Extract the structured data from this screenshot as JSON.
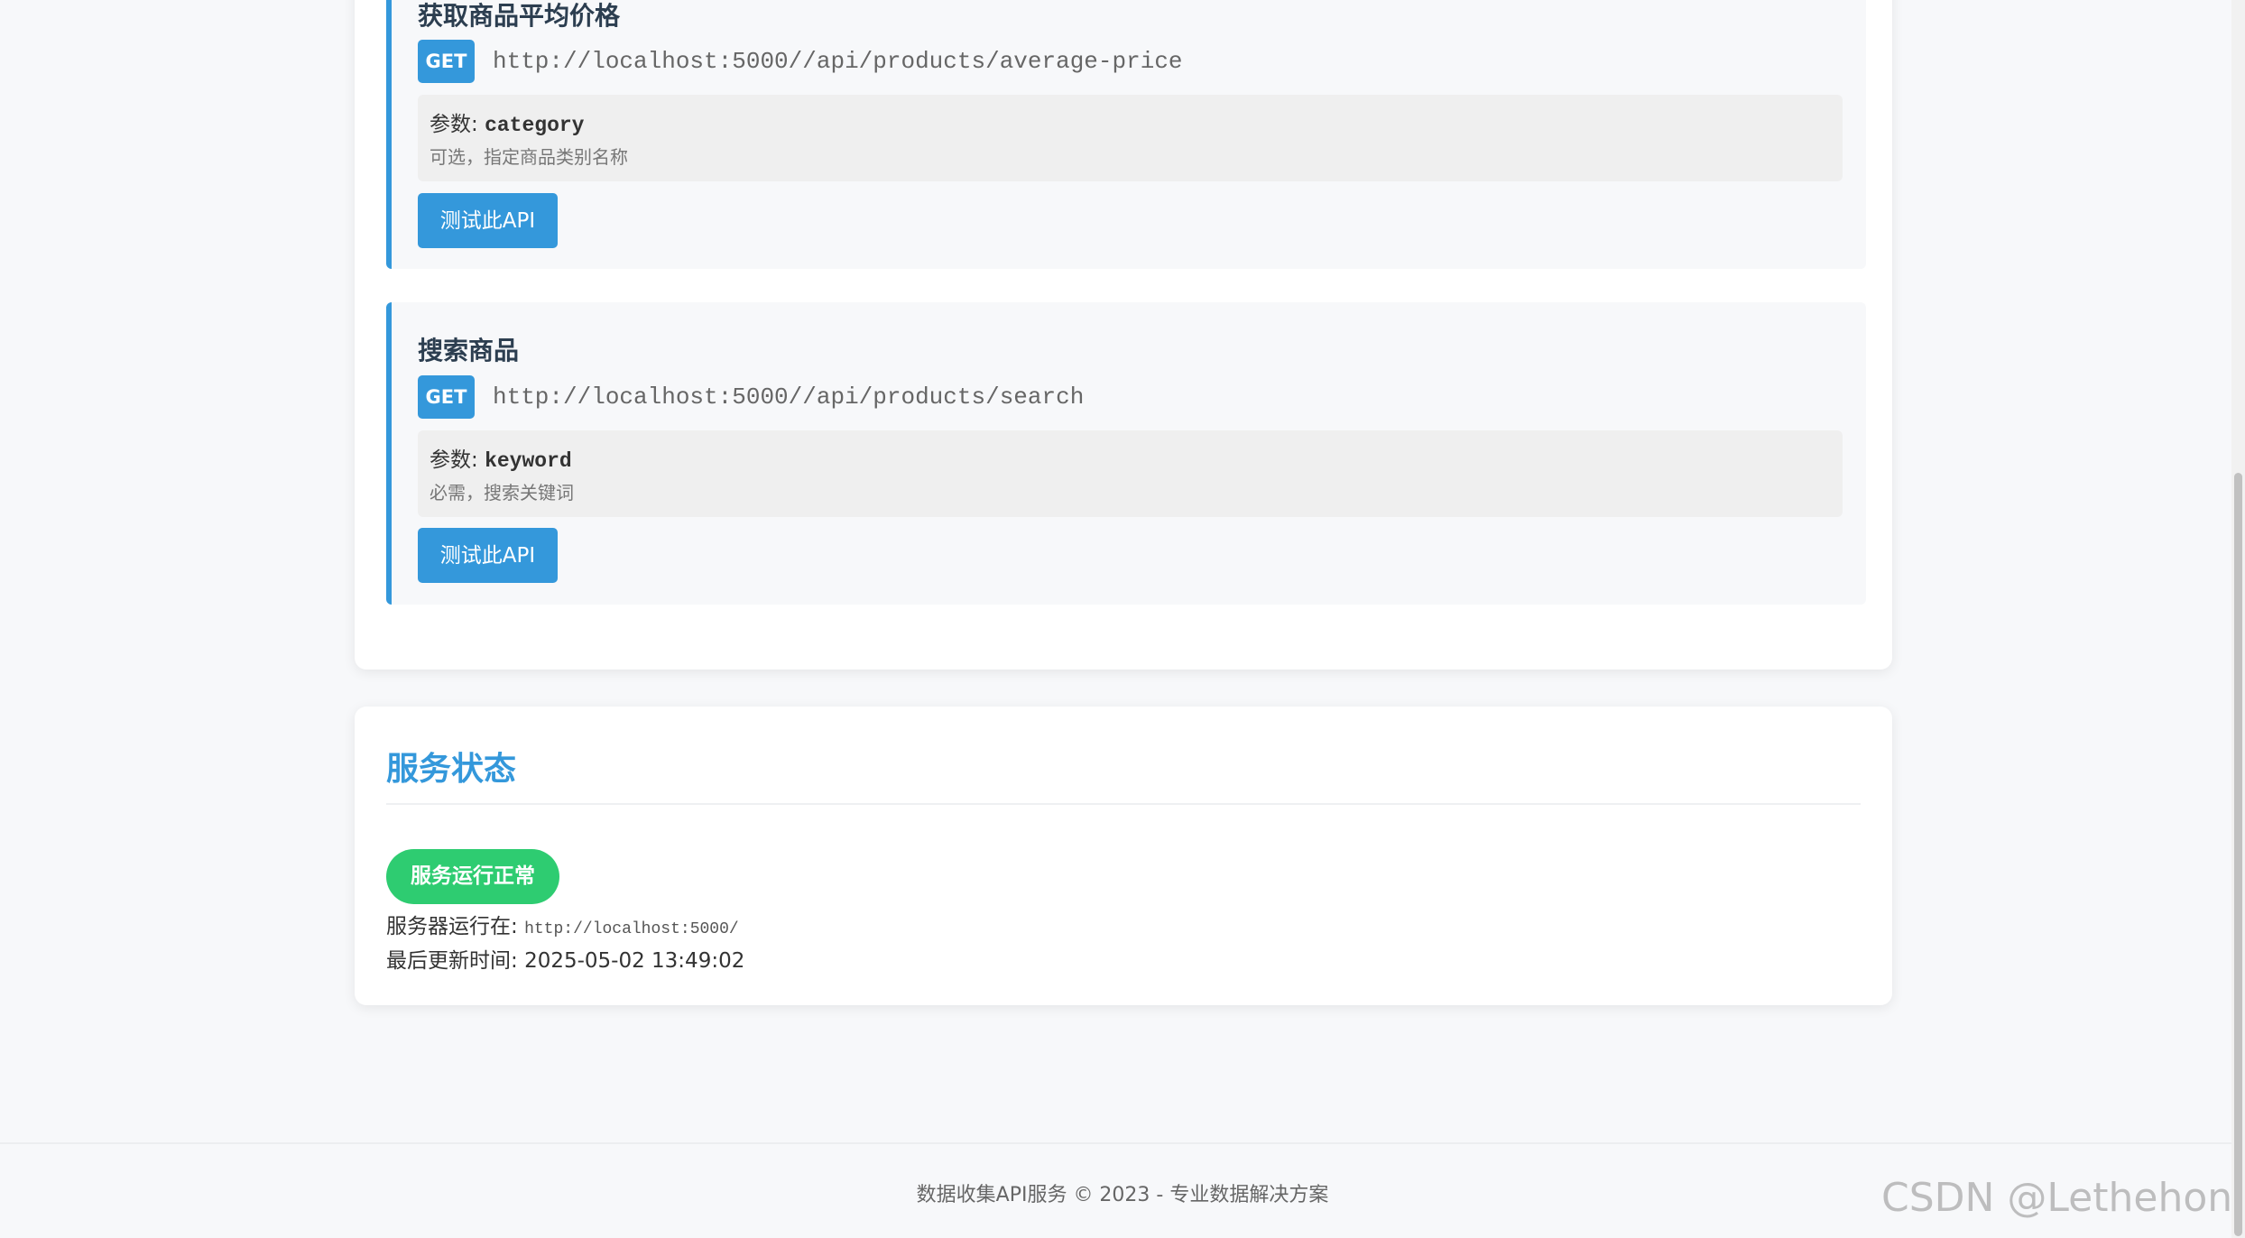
{
  "endpoints": [
    {
      "title": "获取商品平均价格",
      "method": "GET",
      "url": "http://localhost:5000//api/products/average-price",
      "param_label": "参数: ",
      "param_name": "category",
      "param_desc": "可选，指定商品类别名称",
      "button_label": "测试此API"
    },
    {
      "title": "搜索商品",
      "method": "GET",
      "url": "http://localhost:5000//api/products/search",
      "param_label": "参数: ",
      "param_name": "keyword",
      "param_desc": "必需，搜索关键词",
      "button_label": "测试此API"
    }
  ],
  "status": {
    "title": "服务状态",
    "badge": "服务运行正常",
    "server_label": "服务器运行在: ",
    "server_url": "http://localhost:5000/",
    "updated_label": "最后更新时间: ",
    "updated_value": "2025-05-02 13:49:02"
  },
  "footer": {
    "text": "数据收集API服务 © 2023 - 专业数据解决方案"
  },
  "watermark": "CSDN @Lethehong",
  "colors": {
    "accent": "#3498db",
    "success": "#2ecc71"
  }
}
